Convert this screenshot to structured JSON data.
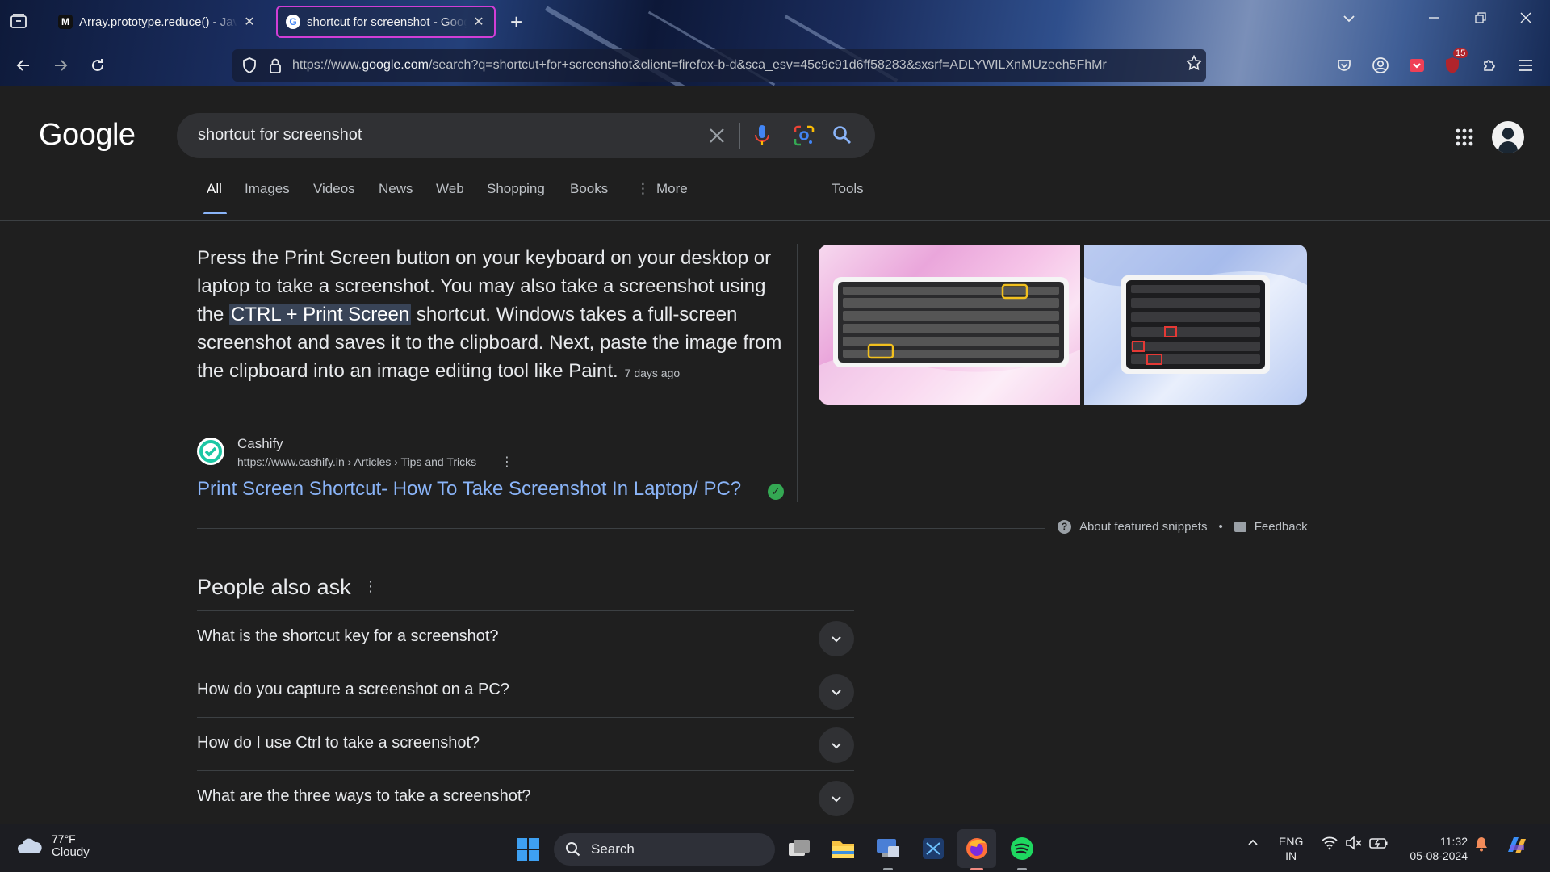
{
  "browser": {
    "tabs": [
      {
        "title": "Array.prototype.reduce() - JavaScript | MDN",
        "favicon": "M",
        "active": false
      },
      {
        "title": "shortcut for screenshot - Google Search",
        "favicon": "G",
        "active": true
      }
    ],
    "url_prefix": "https://www.",
    "url_domain": "google.com",
    "url_rest": "/search?q=shortcut+for+screenshot&client=firefox-b-d&sca_esv=45c9c91d6ff58283&sxsrf=ADLYWILXnMUzeeh5FhMr",
    "extension_badge": "15"
  },
  "google": {
    "logo": "Google",
    "query": "shortcut for screenshot",
    "tabs": [
      "All",
      "Images",
      "Videos",
      "News",
      "Web",
      "Shopping",
      "Books",
      "More",
      "Tools"
    ],
    "snippet": {
      "text_before": "Press the Print Screen button on your keyboard on your desktop or laptop to take a screenshot. You may also take a screenshot using the ",
      "highlight": "CTRL + Print Screen",
      "text_after": " shortcut. Windows takes a full-screen screenshot and saves it to the clipboard. Next, paste the image from the clipboard into an image editing tool like Paint.",
      "date": "7 days ago"
    },
    "source": {
      "name": "Cashify",
      "url": "https://www.cashify.in › Articles › Tips and Tricks",
      "link_title": "Print Screen Shortcut- How To Take Screenshot In Laptop/ PC?"
    },
    "about_snippets": "About featured snippets",
    "feedback": "Feedback",
    "people_also_ask": {
      "title": "People also ask",
      "questions": [
        "What is the shortcut key for a screenshot?",
        "How do you capture a screenshot on a PC?",
        "How do I use Ctrl to take a screenshot?",
        "What are the three ways to take a screenshot?"
      ]
    }
  },
  "taskbar": {
    "weather_temp": "77°F",
    "weather_cond": "Cloudy",
    "search_label": "Search",
    "lang_line1": "ENG",
    "lang_line2": "IN",
    "time": "11:32",
    "date": "05-08-2024"
  },
  "colors": {
    "accent_link": "#8ab4f8",
    "active_tab_border": "#d13ed6",
    "page_bg": "#1f1f1f"
  }
}
